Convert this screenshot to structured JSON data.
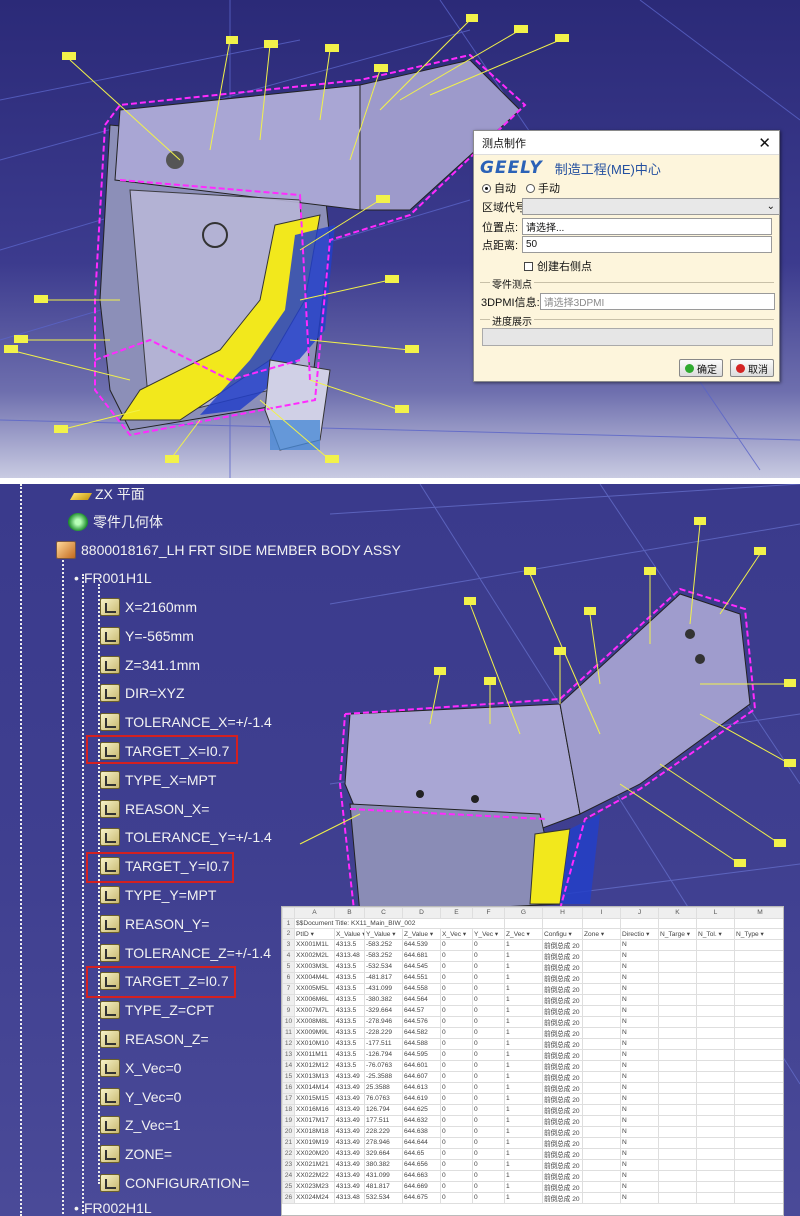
{
  "dialog": {
    "title": "测点制作",
    "close_glyph": "✕",
    "logo": "GEELY",
    "department": "制造工程(ME)中心",
    "mode_auto": "自动",
    "mode_manual": "手动",
    "zone_label": "区域代号:",
    "position_label": "位置点:",
    "position_value": "请选择...",
    "distance_label": "点距离:",
    "distance_value": "50",
    "create_right_label": "创建右侧点",
    "part_group_title": "零件测点",
    "dpmi_label": "3DPMI信息:",
    "dpmi_placeholder": "请选择3DPMI",
    "progress_group_title": "进度展示",
    "ok_label": "确定",
    "cancel_label": "取消",
    "progress": 0,
    "ok_color": "#2faa2f",
    "cancel_color": "#d42424"
  },
  "tree": {
    "zx_plane": "ZX 平面",
    "part_body": "零件几何体",
    "assembly": "8800018167_LH FRT SIDE MEMBER BODY ASSY",
    "point1": "FR001H1L",
    "point2": "FR002H1L",
    "params": [
      "X=2160mm",
      "Y=-565mm",
      "Z=341.1mm",
      "DIR=XYZ",
      "TOLERANCE_X=+/-1.4",
      "TARGET_X=I0.7",
      "TYPE_X=MPT",
      "REASON_X=",
      "TOLERANCE_Y=+/-1.4",
      "TARGET_Y=I0.7",
      "TYPE_Y=MPT",
      "REASON_Y=",
      "TOLERANCE_Z=+/-1.4",
      "TARGET_Z=I0.7",
      "TYPE_Z=CPT",
      "REASON_Z=",
      "X_Vec=0",
      "Y_Vec=0",
      "Z_Vec=1",
      "ZONE=",
      "CONFIGURATION="
    ],
    "highlight_color": "#d42020"
  },
  "spreadsheet": {
    "columns": [
      "A",
      "B",
      "C",
      "D",
      "E",
      "F",
      "G",
      "H",
      "I",
      "J",
      "K",
      "L",
      "M"
    ],
    "rows": [
      [
        "1",
        "$$Document Title: KX11_Main_BIW_002",
        "",
        "",
        "",
        "",
        "",
        "",
        "",
        "",
        "",
        "",
        "",
        ""
      ],
      [
        "2",
        "PtID ▾",
        "X_Value ▾",
        "Y_Value ▾",
        "Z_Value ▾",
        "X_Vec ▾",
        "Y_Vec ▾",
        "Z_Vec ▾",
        "Configu ▾",
        "Zone ▾",
        "Directio ▾",
        "N_Targe ▾",
        "N_Tol. ▾",
        "N_Type ▾"
      ],
      [
        "3",
        "XX001M1L",
        "4313.5",
        "-583.252",
        "644.539",
        "0",
        "0",
        "1",
        "前倒总成 20",
        "",
        "N",
        "",
        "",
        ""
      ],
      [
        "4",
        "XX002M2L",
        "4313.48",
        "-583.252",
        "644.681",
        "0",
        "0",
        "1",
        "前倒总成 20",
        "",
        "N",
        "",
        "",
        ""
      ],
      [
        "5",
        "XX003M3L",
        "4313.5",
        "-532.534",
        "644.545",
        "0",
        "0",
        "1",
        "前倒总成 20",
        "",
        "N",
        "",
        "",
        ""
      ],
      [
        "6",
        "XX004M4L",
        "4313.5",
        "-481.817",
        "644.551",
        "0",
        "0",
        "1",
        "前倒总成 20",
        "",
        "N",
        "",
        "",
        ""
      ],
      [
        "7",
        "XX005M5L",
        "4313.5",
        "-431.099",
        "644.558",
        "0",
        "0",
        "1",
        "前倒总成 20",
        "",
        "N",
        "",
        "",
        ""
      ],
      [
        "8",
        "XX006M6L",
        "4313.5",
        "-380.382",
        "644.564",
        "0",
        "0",
        "1",
        "前倒总成 20",
        "",
        "N",
        "",
        "",
        ""
      ],
      [
        "9",
        "XX007M7L",
        "4313.5",
        "-329.664",
        "644.57",
        "0",
        "0",
        "1",
        "前倒总成 20",
        "",
        "N",
        "",
        "",
        ""
      ],
      [
        "10",
        "XX008M8L",
        "4313.5",
        "-278.946",
        "644.576",
        "0",
        "0",
        "1",
        "前倒总成 20",
        "",
        "N",
        "",
        "",
        ""
      ],
      [
        "11",
        "XX009M9L",
        "4313.5",
        "-228.229",
        "644.582",
        "0",
        "0",
        "1",
        "前倒总成 20",
        "",
        "N",
        "",
        "",
        ""
      ],
      [
        "12",
        "XX010M10",
        "4313.5",
        "-177.511",
        "644.588",
        "0",
        "0",
        "1",
        "前倒总成 20",
        "",
        "N",
        "",
        "",
        ""
      ],
      [
        "13",
        "XX011M11",
        "4313.5",
        "-126.794",
        "644.595",
        "0",
        "0",
        "1",
        "前倒总成 20",
        "",
        "N",
        "",
        "",
        ""
      ],
      [
        "14",
        "XX012M12",
        "4313.5",
        "-76.0763",
        "644.601",
        "0",
        "0",
        "1",
        "前倒总成 20",
        "",
        "N",
        "",
        "",
        ""
      ],
      [
        "15",
        "XX013M13",
        "4313.49",
        "-25.3588",
        "644.607",
        "0",
        "0",
        "1",
        "前倒总成 20",
        "",
        "N",
        "",
        "",
        ""
      ],
      [
        "16",
        "XX014M14",
        "4313.49",
        "25.3588",
        "644.613",
        "0",
        "0",
        "1",
        "前倒总成 20",
        "",
        "N",
        "",
        "",
        ""
      ],
      [
        "17",
        "XX015M15",
        "4313.49",
        "76.0763",
        "644.619",
        "0",
        "0",
        "1",
        "前倒总成 20",
        "",
        "N",
        "",
        "",
        ""
      ],
      [
        "18",
        "XX016M16",
        "4313.49",
        "126.794",
        "644.625",
        "0",
        "0",
        "1",
        "前倒总成 20",
        "",
        "N",
        "",
        "",
        ""
      ],
      [
        "19",
        "XX017M17",
        "4313.49",
        "177.511",
        "644.632",
        "0",
        "0",
        "1",
        "前倒总成 20",
        "",
        "N",
        "",
        "",
        ""
      ],
      [
        "20",
        "XX018M18",
        "4313.49",
        "228.229",
        "644.638",
        "0",
        "0",
        "1",
        "前倒总成 20",
        "",
        "N",
        "",
        "",
        ""
      ],
      [
        "21",
        "XX019M19",
        "4313.49",
        "278.946",
        "644.644",
        "0",
        "0",
        "1",
        "前倒总成 20",
        "",
        "N",
        "",
        "",
        ""
      ],
      [
        "22",
        "XX020M20",
        "4313.49",
        "329.664",
        "644.65",
        "0",
        "0",
        "1",
        "前倒总成 20",
        "",
        "N",
        "",
        "",
        ""
      ],
      [
        "23",
        "XX021M21",
        "4313.49",
        "380.382",
        "644.656",
        "0",
        "0",
        "1",
        "前倒总成 20",
        "",
        "N",
        "",
        "",
        ""
      ],
      [
        "24",
        "XX022M22",
        "4313.49",
        "431.099",
        "644.663",
        "0",
        "0",
        "1",
        "前倒总成 20",
        "",
        "N",
        "",
        "",
        ""
      ],
      [
        "25",
        "XX023M23",
        "4313.49",
        "481.817",
        "644.669",
        "0",
        "0",
        "1",
        "前倒总成 20",
        "",
        "N",
        "",
        "",
        ""
      ],
      [
        "26",
        "XX024M24",
        "4313.48",
        "532.534",
        "644.675",
        "0",
        "0",
        "1",
        "前倒总成 20",
        "",
        "N",
        "",
        "",
        ""
      ]
    ]
  }
}
